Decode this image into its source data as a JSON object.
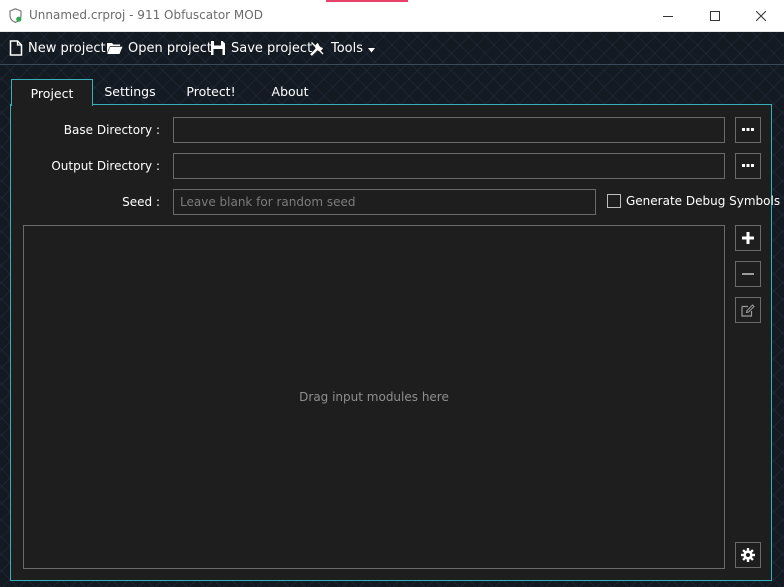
{
  "window": {
    "title": "Unnamed.crproj - 911 Obfuscator MOD",
    "icon": "shield-icon",
    "controls": [
      "minimize-icon",
      "maximize-icon",
      "close-icon"
    ]
  },
  "toolbar": {
    "new_project": "New project",
    "open_project": "Open project",
    "save_project": "Save project",
    "tools": "Tools"
  },
  "tabs": [
    {
      "label": "Project",
      "active": true
    },
    {
      "label": "Settings",
      "active": false
    },
    {
      "label": "Protect!",
      "active": false
    },
    {
      "label": "About",
      "active": false
    }
  ],
  "project": {
    "base_directory_label": "Base Directory :",
    "base_directory_value": "",
    "output_directory_label": "Output Directory :",
    "output_directory_value": "",
    "seed_label": "Seed :",
    "seed_value": "",
    "seed_placeholder": "Leave blank for random seed",
    "debug_symbols_label": "Generate Debug Symbols",
    "debug_symbols_checked": false,
    "modules_hint": "Drag input modules here",
    "module_buttons": [
      "plus-icon",
      "minus-icon",
      "edit-icon",
      "gear-icon"
    ]
  },
  "colors": {
    "accent": "#35b0b8",
    "panel_bg": "#1e1e1e",
    "border": "#6a6a6a",
    "titlebar_accent": "#e8426a"
  }
}
